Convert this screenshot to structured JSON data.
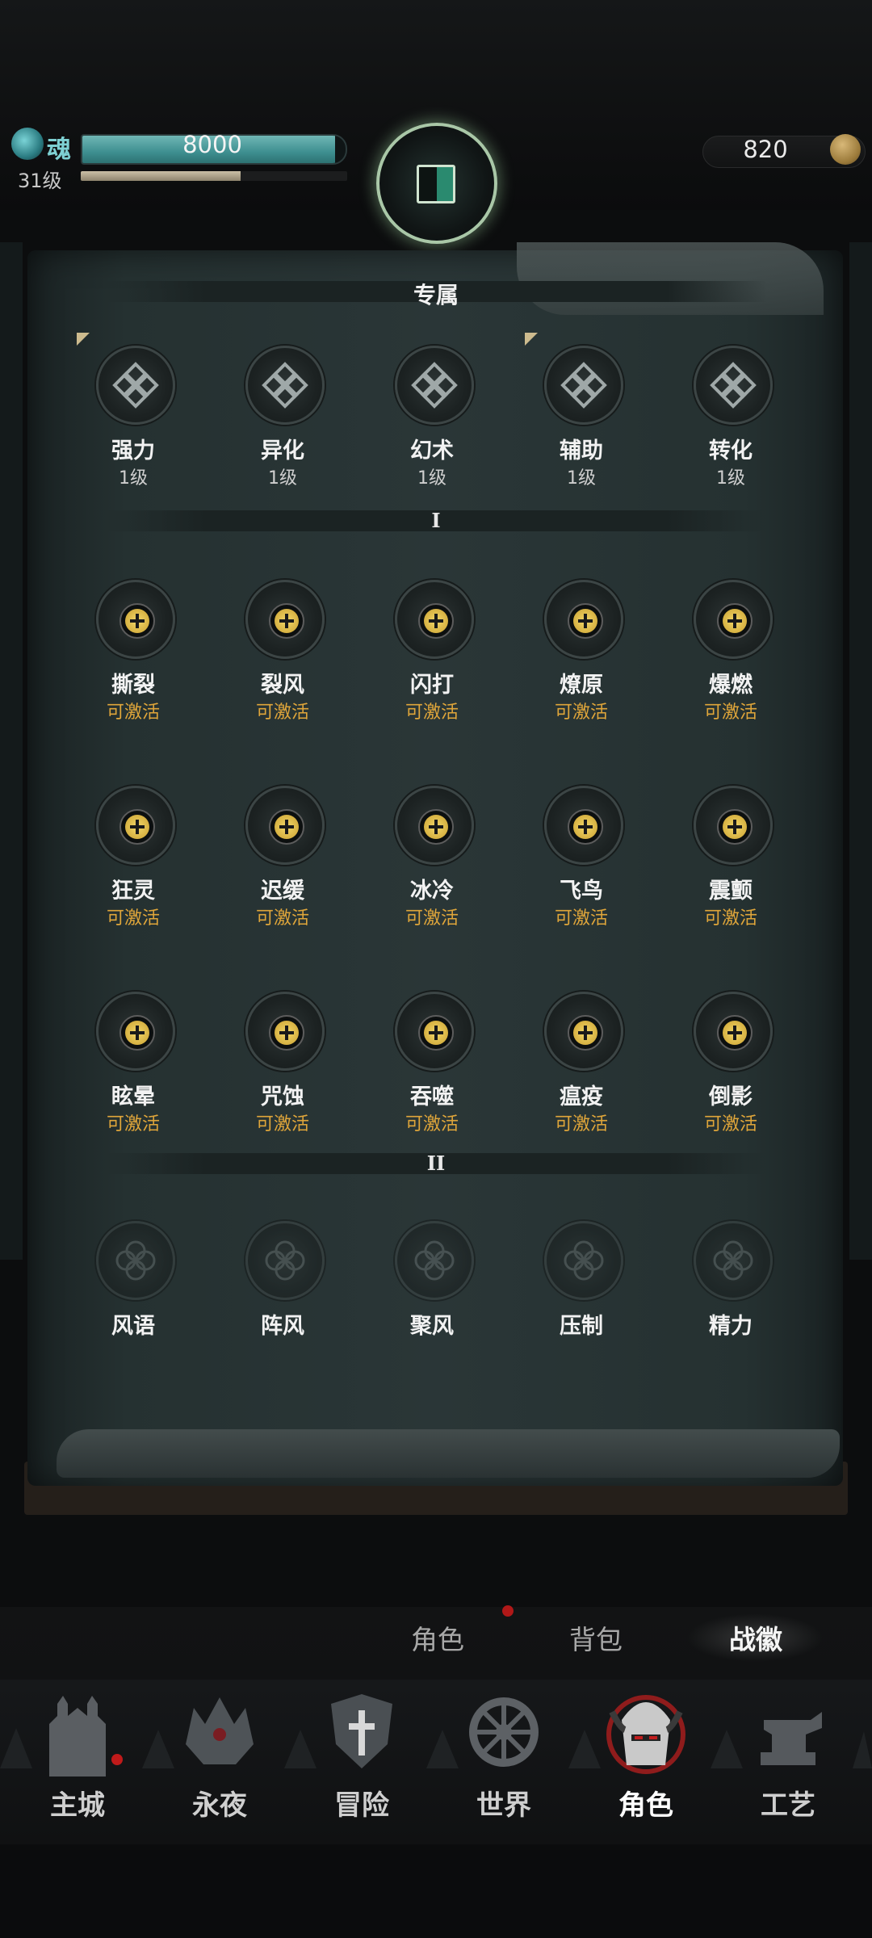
{
  "header": {
    "soul_label": "魂",
    "soul_value": "8000",
    "soul_fill": 0.96,
    "level": "31级",
    "xp_fill": 0.6,
    "gold": "820"
  },
  "panel": {
    "title": "专属",
    "exclusive": [
      {
        "name": "强力",
        "level": "1级",
        "corner": true
      },
      {
        "name": "异化",
        "level": "1级",
        "corner": false
      },
      {
        "name": "幻术",
        "level": "1级",
        "corner": false
      },
      {
        "name": "辅助",
        "level": "1级",
        "corner": true
      },
      {
        "name": "转化",
        "level": "1级",
        "corner": false
      }
    ],
    "tier1_label": "I",
    "tier1": [
      {
        "name": "撕裂",
        "status": "可激活"
      },
      {
        "name": "裂风",
        "status": "可激活"
      },
      {
        "name": "闪打",
        "status": "可激活"
      },
      {
        "name": "燎原",
        "status": "可激活"
      },
      {
        "name": "爆燃",
        "status": "可激活"
      },
      {
        "name": "狂灵",
        "status": "可激活"
      },
      {
        "name": "迟缓",
        "status": "可激活"
      },
      {
        "name": "冰冷",
        "status": "可激活"
      },
      {
        "name": "飞鸟",
        "status": "可激活"
      },
      {
        "name": "震颤",
        "status": "可激活"
      },
      {
        "name": "眩晕",
        "status": "可激活"
      },
      {
        "name": "咒蚀",
        "status": "可激活"
      },
      {
        "name": "吞噬",
        "status": "可激活"
      },
      {
        "name": "瘟疫",
        "status": "可激活"
      },
      {
        "name": "倒影",
        "status": "可激活"
      }
    ],
    "tier2_label": "II",
    "tier2": [
      {
        "name": "风语"
      },
      {
        "name": "阵风"
      },
      {
        "name": "聚风"
      },
      {
        "name": "压制"
      },
      {
        "name": "精力"
      }
    ]
  },
  "subtabs": {
    "role": "角色",
    "bag": "背包",
    "badge": "战徽"
  },
  "nav": [
    {
      "label": "主城",
      "icon": "castle-icon"
    },
    {
      "label": "永夜",
      "icon": "dark-crown-icon"
    },
    {
      "label": "冒险",
      "icon": "cross-shield-icon"
    },
    {
      "label": "世界",
      "icon": "wheel-icon"
    },
    {
      "label": "角色",
      "icon": "helmet-icon"
    },
    {
      "label": "工艺",
      "icon": "anvil-icon"
    }
  ],
  "colors": {
    "accent_gold": "#e0a63a",
    "soul_teal": "#4d9e9e",
    "active_ring": "#a9c7a7",
    "notify_red": "#c01a1a"
  }
}
